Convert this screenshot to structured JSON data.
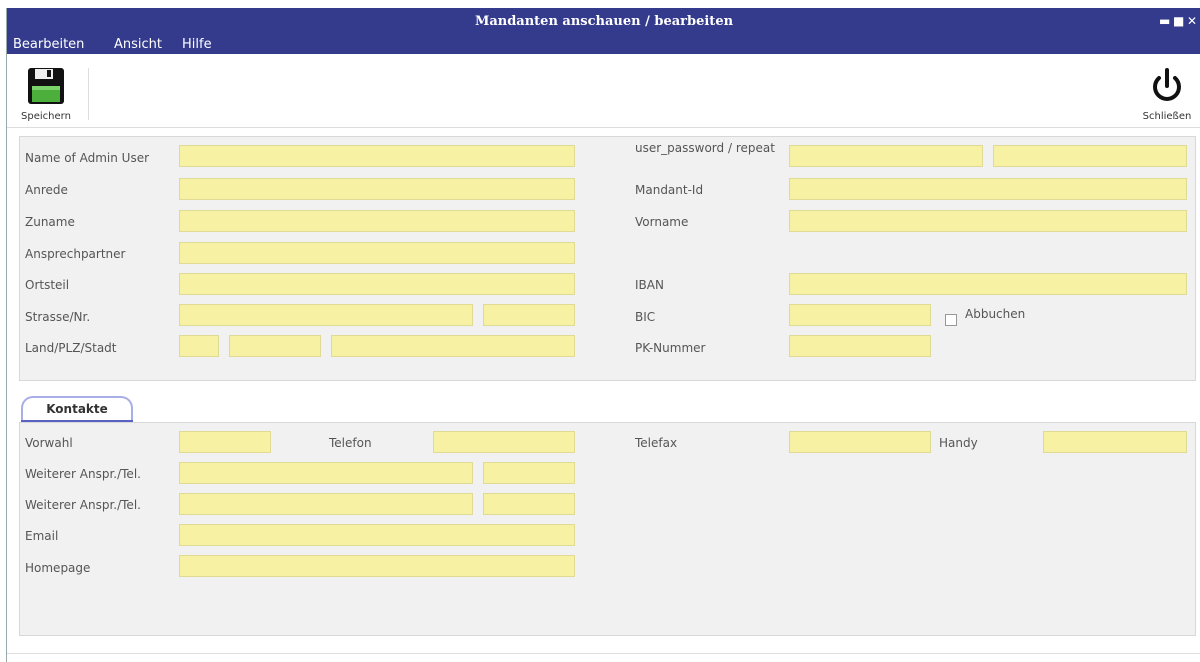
{
  "window": {
    "title": "Mandanten anschauen / bearbeiten"
  },
  "menu": [
    "Bearbeiten",
    "Ansicht",
    "Hilfe"
  ],
  "toolbar": {
    "save_label": "Speichern",
    "close_label": "Schließen"
  },
  "form": {
    "name_admin": "Name of Admin User",
    "password": "user_password / repeat",
    "anrede": "Anrede",
    "mandant_id": "Mandant-Id",
    "zuname": "Zuname",
    "vorname": "Vorname",
    "ansprechpartner": "Ansprechpartner",
    "ortsteil": "Ortsteil",
    "iban": "IBAN",
    "strasse": "Strasse/Nr.",
    "bic": "BIC",
    "abbuchen": "Abbuchen",
    "land": "Land/PLZ/Stadt",
    "pk_nummer": "PK-Nummer"
  },
  "tabs": {
    "kontakte": "Kontakte"
  },
  "contacts": {
    "vorwahl": "Vorwahl",
    "telefon": "Telefon",
    "telefax": "Telefax",
    "handy": "Handy",
    "weiterer1": "Weiterer Anspr./Tel.",
    "weiterer2": "Weiterer Anspr./Tel.",
    "email": "Email",
    "homepage": "Homepage"
  },
  "colors": {
    "titlebar": "#343b8c",
    "field": "#f6f1a3",
    "panel": "#f1f1f1"
  }
}
